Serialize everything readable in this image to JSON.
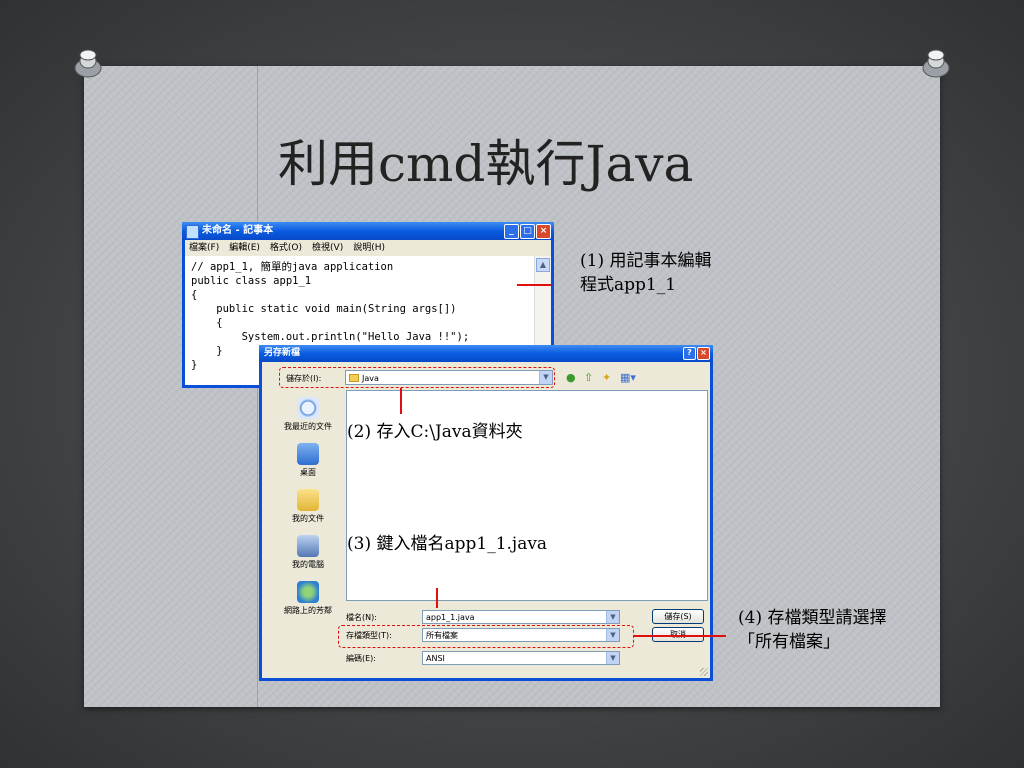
{
  "slide": {
    "title": "利用cmd執行Java"
  },
  "notepad": {
    "title": "未命名 - 記事本",
    "menu": [
      "檔案(F)",
      "編輯(E)",
      "格式(O)",
      "檢視(V)",
      "說明(H)"
    ],
    "code": "// app1_1, 簡單的java application\npublic class app1_1\n{\n    public static void main(String args[])\n    {\n        System.out.println(\"Hello Java !!\");\n    }\n}"
  },
  "dialog": {
    "title": "另存新檔",
    "save_in_label": "儲存於(I):",
    "save_in_value": "Java",
    "places": [
      "我最近的文件",
      "桌面",
      "我的文件",
      "我的電腦",
      "網路上的芳鄰"
    ],
    "filename_label": "檔名(N):",
    "filename_value": "app1_1.java",
    "filetype_label": "存檔類型(T):",
    "filetype_value": "所有檔案",
    "encoding_label": "編碼(E):",
    "encoding_value": "ANSI",
    "save_button": "儲存(S)",
    "cancel_button": "取消"
  },
  "annotations": {
    "step1_line1": "(1)  用記事本編輯",
    "step1_line2": "程式app1_1",
    "step2": "(2) 存入C:\\Java資料夾",
    "step3": "(3) 鍵入檔名app1_1.java",
    "step4_line1": "(4)  存檔類型請選擇",
    "step4_line2": "「所有檔案」"
  },
  "colors": {
    "annotation_red": "#e01010",
    "xp_titlebar": "#0a5ce0"
  }
}
